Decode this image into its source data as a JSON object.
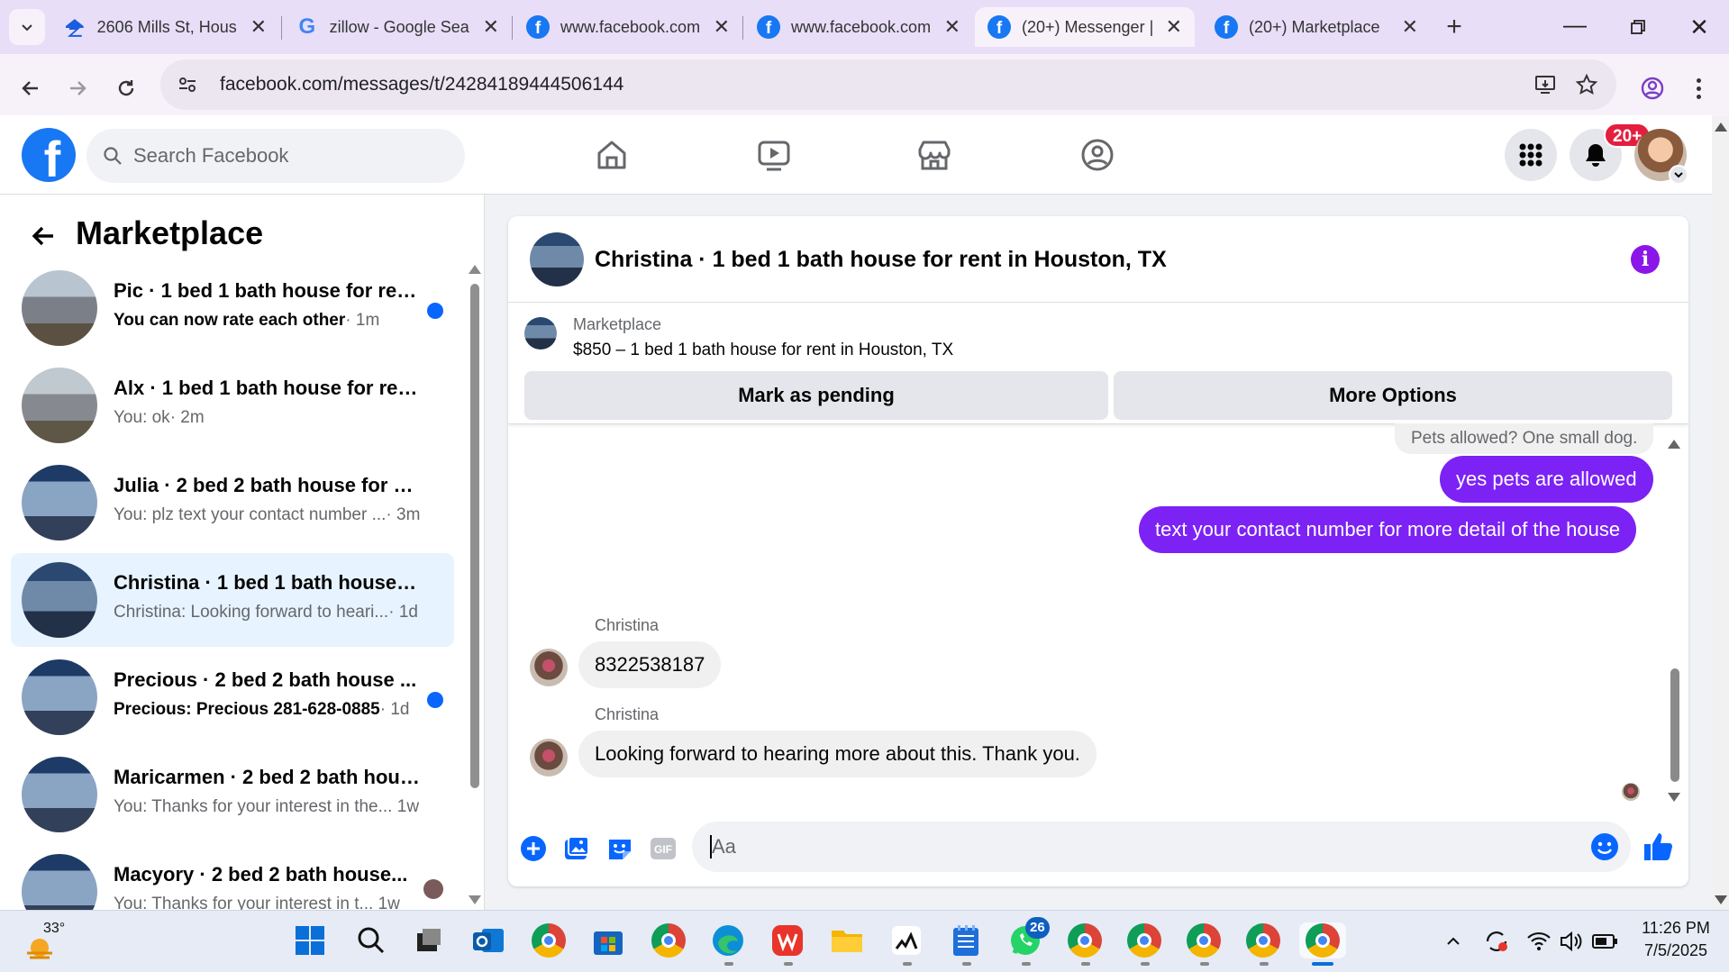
{
  "browser": {
    "tabs": [
      {
        "title": "2606 Mills St, Hous"
      },
      {
        "title": "zillow - Google Sea"
      },
      {
        "title": "www.facebook.com"
      },
      {
        "title": "www.facebook.com"
      },
      {
        "title": "(20+) Messenger |"
      },
      {
        "title": "(20+) Marketplace"
      }
    ],
    "url": "facebook.com/messages/t/24284189444506144"
  },
  "fb": {
    "search_placeholder": "Search Facebook",
    "notif_badge": "20+"
  },
  "left": {
    "title": "Marketplace",
    "conversations": [
      {
        "name": "Pic · 1 bed 1 bath house for ren...",
        "preview": "You can now rate each other",
        "time": "· 1m",
        "unread": true
      },
      {
        "name": "Alx · 1 bed 1 bath house for rent ...",
        "preview": "You: ok",
        "time": "· 2m",
        "unread": false
      },
      {
        "name": "Julia · 2 bed 2 bath house for re...",
        "preview": "You: plz text your contact number ...",
        "time": "· 3m",
        "unread": false
      },
      {
        "name": "Christina · 1 bed 1 bath house fo...",
        "preview": "Christina: Looking forward to heari...",
        "time": "· 1d",
        "unread": false
      },
      {
        "name": "Precious · 2 bed 2 bath house ...",
        "preview": "Precious: Precious 281-628-0885",
        "time": "· 1d",
        "unread": true
      },
      {
        "name": "Maricarmen · 2 bed 2 bath hous...",
        "preview": "You: Thanks for your interest in the...",
        "time": " 1w",
        "unread": false
      },
      {
        "name": "Macyory · 2 bed 2 bath house...",
        "preview": "You: Thanks for your interest in t...",
        "time": " 1w",
        "unread": false
      }
    ]
  },
  "chat": {
    "title": "Christina · 1 bed 1 bath house for rent in Houston, TX",
    "listing_source": "Marketplace",
    "listing_desc": "$850 – 1 bed 1 bath house for rent in Houston, TX",
    "btn_pending": "Mark as pending",
    "btn_more": "More Options",
    "messages": {
      "partial": "Pets allowed? One small dog.",
      "me1": "yes pets are allowed",
      "me2": "text your contact number for more detail of the house",
      "sender": "Christina",
      "them1": "8322538187",
      "them2": "Looking forward to hearing more about this. Thank you."
    },
    "composer_placeholder": "Aa"
  },
  "taskbar": {
    "weather_temp": "33°",
    "whatsapp_badge": "26",
    "time": "11:26 PM",
    "date": "7/5/2025"
  },
  "colors": {
    "accent_purple": "#7c22f5",
    "fb_blue": "#1877f2",
    "notif_red": "#e41e3f"
  }
}
